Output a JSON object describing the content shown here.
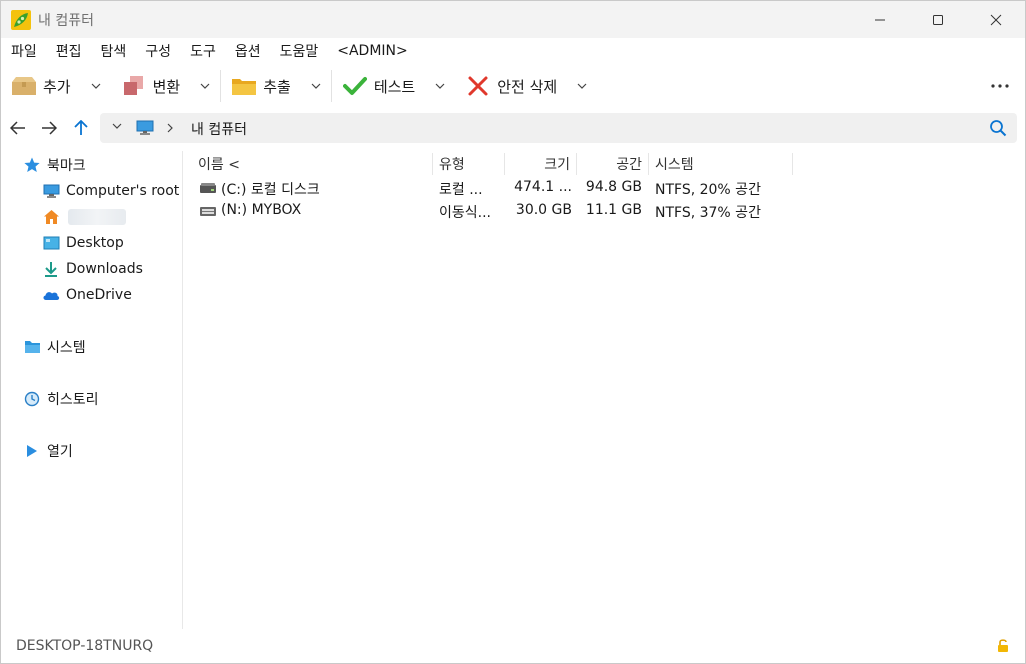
{
  "window": {
    "title": "내 컴퓨터",
    "controls": [
      "minimize",
      "maximize",
      "close"
    ]
  },
  "menu": [
    "파일",
    "편집",
    "탐색",
    "구성",
    "도구",
    "옵션",
    "도움말",
    "<ADMIN>"
  ],
  "toolbar": {
    "add_label": "추가",
    "convert_label": "변환",
    "extract_label": "추출",
    "test_label": "테스트",
    "delete_label": "안전 삭제",
    "more_icon": "more-icon"
  },
  "address": {
    "path": "내 컴퓨터",
    "icon": "computer-icon"
  },
  "sidebar": {
    "bookmarks_label": "북마크",
    "bookmarks": [
      "Computer's root",
      "",
      "Desktop",
      "Downloads",
      "OneDrive"
    ],
    "system_label": "시스템",
    "history_label": "히스토리",
    "open_label": "열기"
  },
  "columns": [
    "이름 <",
    "유형",
    "크기",
    "공간",
    "시스템"
  ],
  "rows": [
    {
      "name": "(C:) 로컬 디스크",
      "type": "로컬 ...",
      "size": "474.1 ...",
      "free": "94.8 GB",
      "system": "NTFS, 20% 공간"
    },
    {
      "name": "(N:) MYBOX",
      "type": "이동식...",
      "size": "30.0 GB",
      "free": "11.1 GB",
      "system": "NTFS, 37% 공간"
    }
  ],
  "status": {
    "computer_name": "DESKTOP-18TNURQ"
  },
  "colors": {
    "accent": "#0a74d1",
    "check": "#3bb33b",
    "delete": "#e0382c",
    "folder": "#f4c542"
  }
}
